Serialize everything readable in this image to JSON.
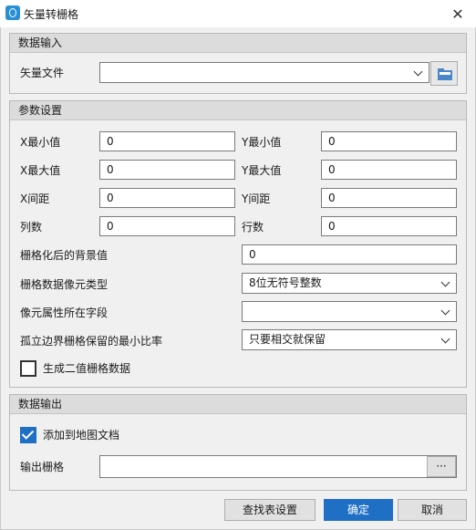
{
  "window": {
    "title": "矢量转栅格",
    "close_glyph": "✕"
  },
  "input_group": {
    "header": "数据输入",
    "vector_file_label": "矢量文件",
    "vector_file_value": ""
  },
  "params_group": {
    "header": "参数设置",
    "xmin_label": "X最小值",
    "xmin_value": "0",
    "ymin_label": "Y最小值",
    "ymin_value": "0",
    "xmax_label": "X最大值",
    "xmax_value": "0",
    "ymax_label": "Y最大值",
    "ymax_value": "0",
    "xspacing_label": "X间距",
    "xspacing_value": "0",
    "yspacing_label": "Y间距",
    "yspacing_value": "0",
    "cols_label": "列数",
    "cols_value": "0",
    "rows_label": "行数",
    "rows_value": "0",
    "background_label": "栅格化后的背景值",
    "background_value": "0",
    "pixel_type_label": "栅格数据像元类型",
    "pixel_type_value": "8位无符号整数",
    "attr_field_label": "像元属性所在字段",
    "attr_field_value": "",
    "min_ratio_label": "孤立边界栅格保留的最小比率",
    "min_ratio_value": "只要相交就保留",
    "binary_label": "生成二值栅格数据",
    "binary_checked": false
  },
  "output_group": {
    "header": "数据输出",
    "add_to_map_label": "添加到地图文档",
    "add_to_map_checked": true,
    "output_raster_label": "输出栅格",
    "output_raster_value": "",
    "browse_label": "···"
  },
  "buttons": {
    "lookup": "查找表设置",
    "ok": "确定",
    "cancel": "取消"
  },
  "colors": {
    "accent": "#1f6fc5",
    "header_bg": "#dcdcdc"
  }
}
